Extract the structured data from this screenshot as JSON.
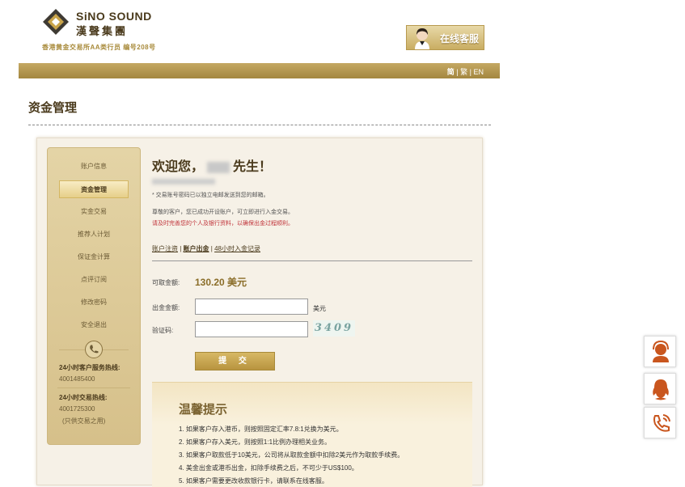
{
  "header": {
    "brand_en": "SiNO SOUND",
    "brand_cn": "漢聲集團",
    "member_line": "香港黄金交易所AA类行员 编号208号",
    "cs_banner_label": "在线客服",
    "colors": {
      "gold": "#b8943f",
      "brown": "#4a3a1c"
    }
  },
  "lang_bar": {
    "simplified": "简",
    "traditional": "繁",
    "english": "EN",
    "sep": "|"
  },
  "page_title": "资金管理",
  "sidebar": {
    "items": [
      {
        "label": "账户信息",
        "active": false
      },
      {
        "label": "资金管理",
        "active": true
      },
      {
        "label": "实金交易",
        "active": false
      },
      {
        "label": "推荐人计划",
        "active": false
      },
      {
        "label": "保证金计算",
        "active": false
      },
      {
        "label": "点评订阅",
        "active": false
      },
      {
        "label": "修改密码",
        "active": false
      },
      {
        "label": "安全退出",
        "active": false
      }
    ],
    "service_hotline_title": "24小时客户服务热线:",
    "service_hotline": "4001485400",
    "trade_hotline_title": "24小时交易热线:",
    "trade_hotline": "4001725300",
    "trade_hotline_note": "(只供交易之用)"
  },
  "main": {
    "welcome_prefix": "欢迎您，",
    "welcome_suffix": "先生！",
    "note_password": "* 交易账号密码已以独立电邮发送到您的邮箱。",
    "note_opened": "尊敬的客户，您已成功开设账户，可立即进行入金交易。",
    "note_warning": "请及时完善您的个人及银行资料，以确保出金过程顺利。",
    "tabs": [
      {
        "label": "账户注资",
        "current": false
      },
      {
        "label": "账户出金",
        "current": true
      },
      {
        "label": "48小时入金记录",
        "current": false
      }
    ],
    "available_label": "可取金额:",
    "available_amount": "130.20 美元",
    "withdraw_label": "出金金额:",
    "withdraw_value": "",
    "withdraw_unit": "美元",
    "captcha_label": "验证码:",
    "captcha_value": "",
    "captcha_text": "3409",
    "submit_label": "提 交"
  },
  "tips": {
    "title": "温馨提示",
    "items": [
      "1. 如果客户存入港币，则按照固定汇率7.8:1兑换为美元。",
      "2. 如果客户存入美元，则按照1:1比例办理相关业务。",
      "3. 如果客户取款低于10美元，公司将从取款金额中扣除2美元作为取款手续费。",
      "4. 美金出金或港币出金，扣除手续费之后，不可少于US$100。",
      "5. 如果客户需要更改收款银行卡，请联系在线客服。"
    ]
  },
  "float_buttons": [
    {
      "icon": "customer-service-icon"
    },
    {
      "icon": "qq-icon"
    },
    {
      "icon": "phone-icon"
    }
  ]
}
